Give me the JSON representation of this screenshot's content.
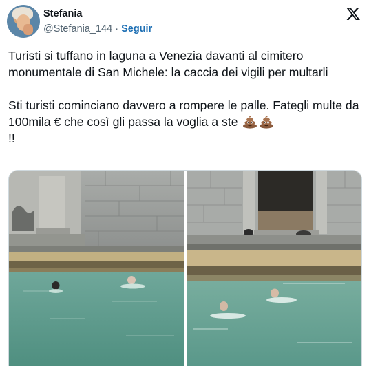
{
  "author": {
    "display_name": "Stefania",
    "handle": "@Stefania_144",
    "separator": "·",
    "follow_label": "Seguir"
  },
  "brand": {
    "logo": "x-logo-icon",
    "text_color": "#0f1419",
    "muted_color": "#536471",
    "link_color": "#1d6fb4"
  },
  "tweet": {
    "paragraph1": "Turisti si tuffano in laguna a Venezia davanti al cimitero monumentale di San Michele: la caccia dei vigili per multarli",
    "paragraph2": "Sti turisti cominciano davvero a rompere le palle. Fategli multe da 100mila € che così gli passa la voglia a ste",
    "paragraph2_tail": "!!",
    "emojis": [
      "pile-of-poo-icon",
      "pile-of-poo-icon"
    ]
  },
  "media": {
    "images": [
      {
        "name": "photo-swimmers-wall",
        "subject": "swimmers in canal"
      },
      {
        "name": "photo-swimmers-doorway",
        "subject": "swimmers near doorway"
      }
    ]
  }
}
